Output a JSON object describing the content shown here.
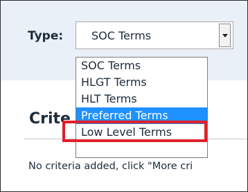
{
  "type_filter": {
    "label": "Type:",
    "selected_value": "SOC Terms",
    "options": [
      {
        "label": "SOC Terms",
        "highlighted": false
      },
      {
        "label": "HLGT Terms",
        "highlighted": false
      },
      {
        "label": "HLT Terms",
        "highlighted": false
      },
      {
        "label": "Preferred Terms",
        "highlighted": true
      },
      {
        "label": "Low Level Terms",
        "highlighted": false
      }
    ]
  },
  "criteria": {
    "title_visible": "Crite",
    "empty_message": "No criteria added, click \"More cri"
  },
  "colors": {
    "panel_background": "#e9f0f7",
    "option_highlight": "#1e90ff",
    "annotation_box": "#e0202a"
  },
  "icons": {
    "dropdown_arrow": "chevron-down-icon"
  }
}
